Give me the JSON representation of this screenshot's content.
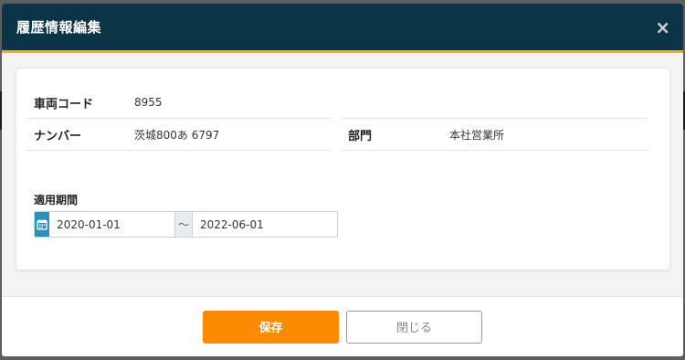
{
  "modal": {
    "title": "履歴情報編集",
    "close_icon": "×"
  },
  "fields": {
    "vehicle_code": {
      "label": "車両コード",
      "value": "8955"
    },
    "plate_number": {
      "label": "ナンバー",
      "value": "茨城800あ 6797"
    },
    "department": {
      "label": "部門",
      "value": "本社営業所"
    }
  },
  "period": {
    "label": "適用期間",
    "start": "2020-01-01",
    "separator": "〜",
    "end": "2022-06-01"
  },
  "footer": {
    "save_label": "保存",
    "close_label": "閉じる"
  },
  "colors": {
    "header_bg": "#0c3447",
    "header_accent": "#f5b400",
    "save_button": "#fb8a00",
    "calendar_button": "#2e8fb8"
  },
  "icons": {
    "close": "close-icon",
    "calendar": "calendar-icon"
  }
}
